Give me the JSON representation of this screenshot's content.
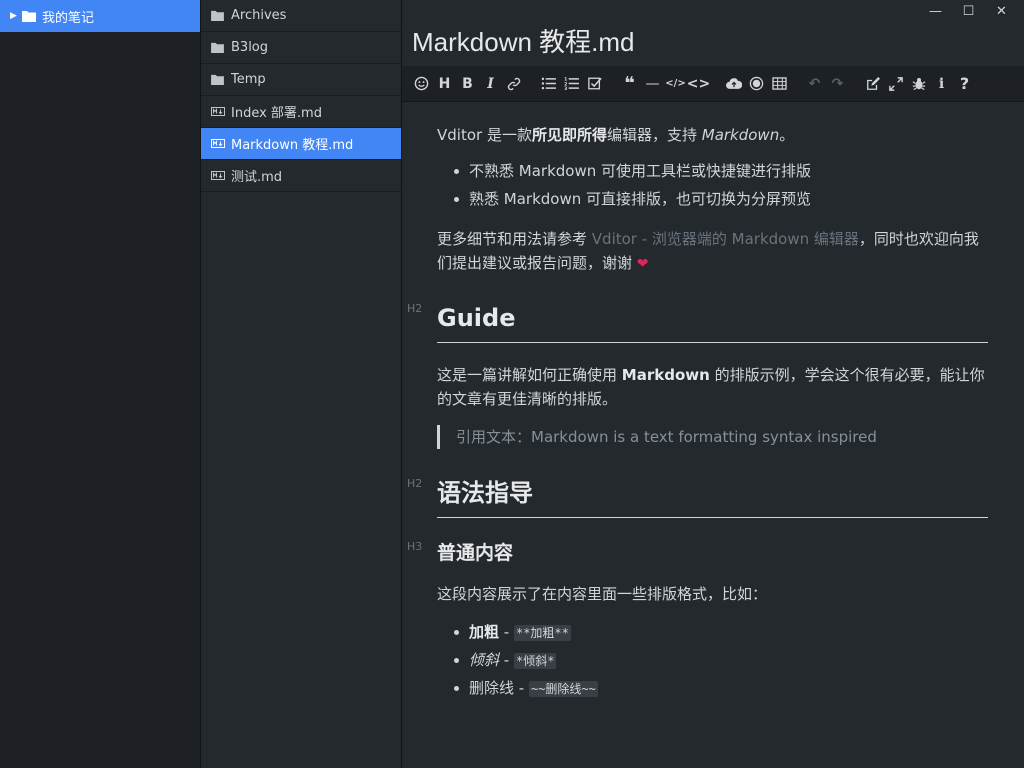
{
  "notebooks": [
    {
      "label": "我的笔记",
      "active": true
    }
  ],
  "files": [
    {
      "label": "Archives",
      "type": "folder"
    },
    {
      "label": "B3log",
      "type": "folder"
    },
    {
      "label": "Temp",
      "type": "folder"
    },
    {
      "label": "Index 部署.md",
      "type": "markdown"
    },
    {
      "label": "Markdown 教程.md",
      "type": "markdown",
      "active": true
    },
    {
      "label": "测试.md",
      "type": "markdown"
    }
  ],
  "window": {
    "minimize": "—",
    "maximize": "☐",
    "close": "✕"
  },
  "editor": {
    "title": "Markdown 教程.md",
    "toolbar": [
      "emoji-icon",
      "headings-icon",
      "bold-icon",
      "italic-icon",
      "link-icon",
      "list-icon",
      "ordered-list-icon",
      "check-icon",
      "quote-icon",
      "line-icon",
      "code-icon",
      "inline-code-icon",
      "upload-icon",
      "record-icon",
      "table-icon",
      "undo-icon",
      "redo-icon",
      "edit-mode-icon",
      "fullscreen-icon",
      "devtools-icon",
      "info-icon",
      "help-icon"
    ]
  },
  "content": {
    "intro_pre": "Vditor 是一款",
    "intro_bold": "所见即所得",
    "intro_mid": "编辑器，支持 ",
    "intro_em": "Markdown",
    "intro_end": "。",
    "bullets": [
      "不熟悉 Markdown 可使用工具栏或快捷键进行排版",
      "熟悉 Markdown 可直接排版，也可切换为分屏预览"
    ],
    "more_pre": "更多细节和用法请参考 ",
    "more_link": "Vditor - 浏览器端的 Markdown 编辑器",
    "more_post": "，同时也欢迎向我们提出建议或报告问题，谢谢 ",
    "heart": "❤",
    "h2_guide": "Guide",
    "guide_pre": "这是一篇讲解如何正确使用 ",
    "guide_bold": "Markdown",
    "guide_post": " 的排版示例，学会这个很有必要，能让你的文章有更佳清晰的排版。",
    "quote": "引用文本：Markdown is a text formatting syntax inspired",
    "h2_syntax": "语法指导",
    "h3_normal": "普通内容",
    "normal_desc": "这段内容展示了在内容里面一些排版格式，比如：",
    "fmt": [
      {
        "label": "加粗",
        "sep": " - ",
        "code": "**加粗**"
      },
      {
        "label": "倾斜",
        "sep": " - ",
        "code": "*倾斜*"
      },
      {
        "label": "删除线",
        "sep": " - ",
        "code": "~~删除线~~"
      }
    ],
    "h2_mark": "H2",
    "h3_mark": "H3"
  }
}
